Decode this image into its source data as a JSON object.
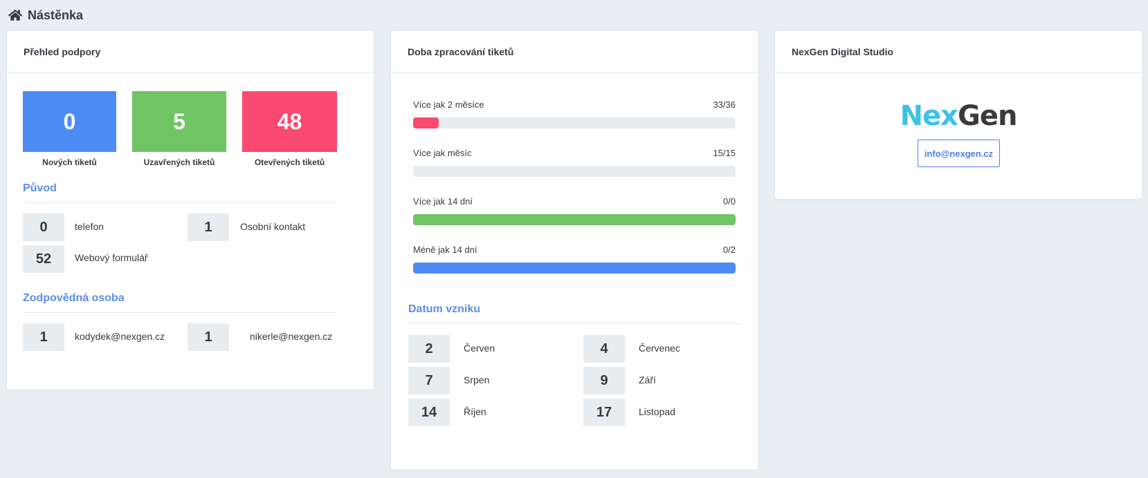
{
  "page": {
    "title": "Nástěnka",
    "icon": "home-icon"
  },
  "support": {
    "title": "Přehled podpory",
    "stats": [
      {
        "value": "0",
        "label": "Nových tiketů",
        "color": "#4e8cf5"
      },
      {
        "value": "5",
        "label": "Uzavřených tiketů",
        "color": "#70c463"
      },
      {
        "value": "48",
        "label": "Otevřených tiketů",
        "color": "#fb4a6f"
      }
    ],
    "origin": {
      "title": "Původ",
      "items": [
        {
          "value": "0",
          "label": "telefon"
        },
        {
          "value": "1",
          "label": "Osobní kontakt"
        },
        {
          "value": "52",
          "label": "Webový formulář"
        }
      ]
    },
    "responsible": {
      "title": "Zodpovědná osoba",
      "items": [
        {
          "value": "1",
          "label": "kodydek@nexgen.cz"
        },
        {
          "value": "1",
          "label": "nikerle@nexgen.cz"
        }
      ]
    }
  },
  "processing": {
    "title": "Doba zpracování tiketů",
    "bars": [
      {
        "label": "Více jak 2 měsíce",
        "value": "33/36",
        "fill_fraction": 0.08,
        "color": "#fb4a6f"
      },
      {
        "label": "Více jak měsíc",
        "value": "15/15",
        "fill_fraction": 0,
        "color": "#4e8cf5"
      },
      {
        "label": "Více jak 14 dní",
        "value": "0/0",
        "fill_fraction": 1,
        "color": "#70c463"
      },
      {
        "label": "Méně jak 14 dní",
        "value": "0/2",
        "fill_fraction": 1,
        "color": "#4e8cf5"
      }
    ],
    "created": {
      "title": "Datum vzniku",
      "items": [
        {
          "value": "2",
          "label": "Červen"
        },
        {
          "value": "4",
          "label": "Červenec"
        },
        {
          "value": "7",
          "label": "Srpen"
        },
        {
          "value": "9",
          "label": "Září"
        },
        {
          "value": "14",
          "label": "Říjen"
        },
        {
          "value": "17",
          "label": "Listopad"
        }
      ]
    }
  },
  "company": {
    "title": "NexGen Digital Studio",
    "logo": {
      "part1": "Nex",
      "part2": "Gen"
    },
    "email": "info@nexgen.cz"
  }
}
